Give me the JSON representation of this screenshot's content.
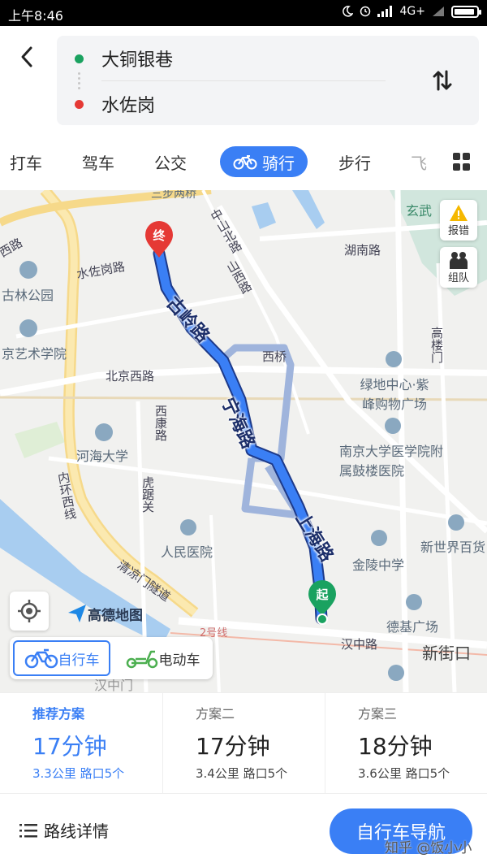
{
  "status_bar": {
    "time": "上午8:46",
    "network": "4G+"
  },
  "route": {
    "origin": "大铜银巷",
    "destination": "水佐岗"
  },
  "tabs": [
    {
      "label": "打车"
    },
    {
      "label": "驾车"
    },
    {
      "label": "公交"
    },
    {
      "label": "骑行"
    },
    {
      "label": "步行"
    },
    {
      "label": "飞"
    }
  ],
  "map": {
    "labels": {
      "sanpailou": "三步两桥",
      "zhongshan_north": "中山北路",
      "xuanwu": "玄武",
      "hunan": "湖南路",
      "xi": "西路",
      "shuizuogang": "水佐岗路",
      "shanxi": "山西路",
      "gulin": "古林公园",
      "art_school": "京艺术学院",
      "xiqiao": "西桥",
      "gaolou": "高楼门",
      "beijing_west": "北京西路",
      "lvdi": "绿地中心·紫峰购物广场",
      "xikang": "西康路",
      "nju_hospital": "南京大学医学院附属鼓楼医院",
      "hohai": "河海大学",
      "neihuan": "内环西线",
      "huju": "虎踞关",
      "renmin": "人民医院",
      "jinling": "金陵中学",
      "xinshijie": "新世界百货",
      "qingliangmen": "清凉门隧道",
      "line2": "2号线",
      "deji": "德基广场",
      "hanzhong": "汉中路",
      "xinjiekou": "新街口",
      "hanzhongmen": "汉中门"
    },
    "route_names": {
      "guling": "古岭路",
      "ninghai": "宁海路",
      "shanghai": "上海路"
    },
    "pins": {
      "end": "终",
      "start": "起"
    },
    "buttons": {
      "report": "报错",
      "team": "组队"
    },
    "logo": "高德地图",
    "vehicles": {
      "bicycle": "自行车",
      "ebike": "电动车"
    }
  },
  "plans": [
    {
      "name": "推荐方案",
      "duration": "17分钟",
      "info": "3.3公里 路口5个"
    },
    {
      "name": "方案二",
      "duration": "17分钟",
      "info": "3.4公里 路口5个"
    },
    {
      "name": "方案三",
      "duration": "18分钟",
      "info": "3.6公里 路口5个"
    }
  ],
  "footer": {
    "detail": "路线详情",
    "navigate": "自行车导航",
    "watermark": "知乎 @饭小小"
  },
  "colors": {
    "accent": "#3a7ff5",
    "start": "#1aa260",
    "end": "#e53935",
    "route": "#3a7ff5"
  }
}
